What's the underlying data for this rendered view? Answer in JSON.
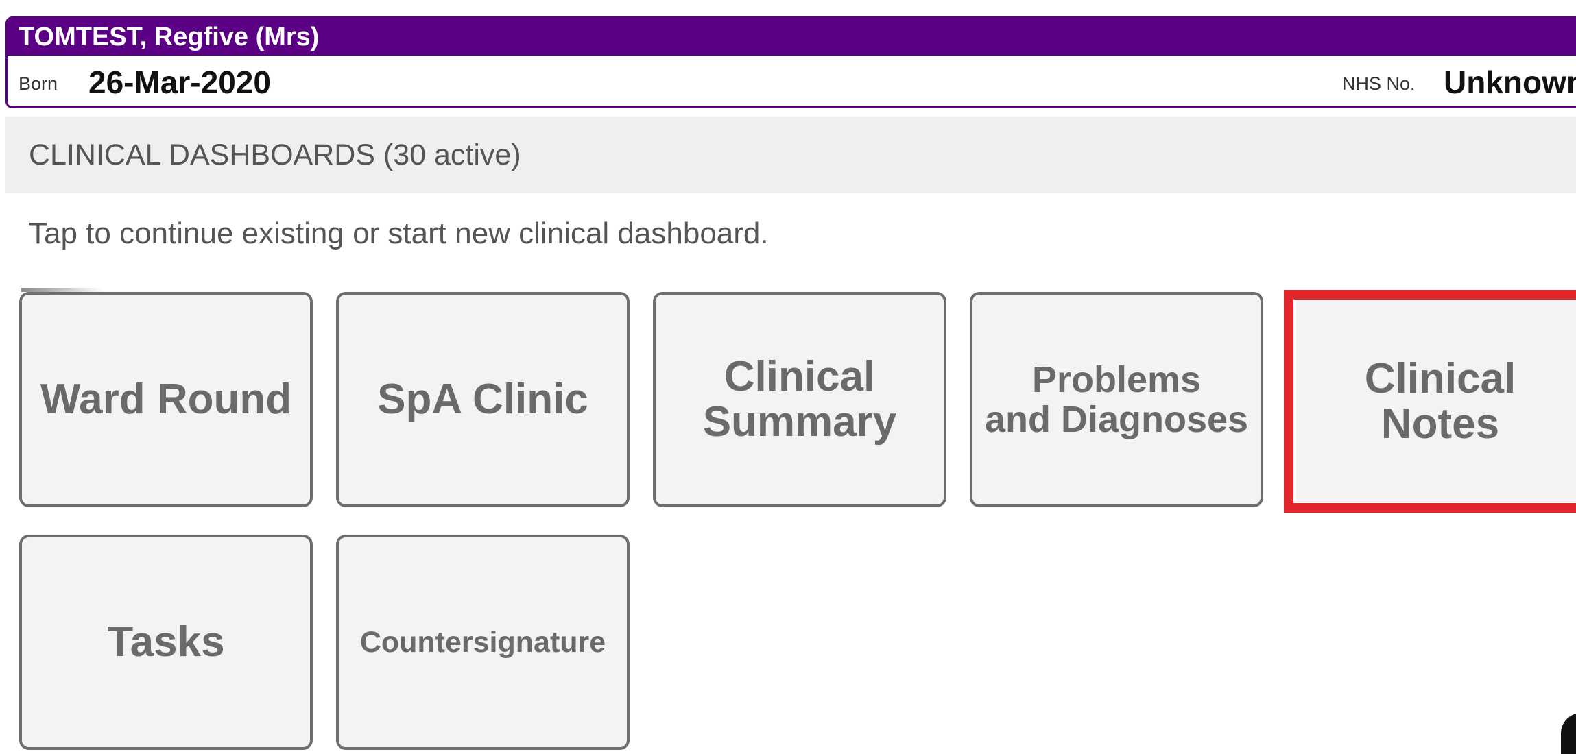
{
  "patient": {
    "name": "TOMTEST, Regfive (Mrs)",
    "born_label": "Born",
    "born_value": "26-Mar-2020",
    "nhs_label": "NHS No.",
    "nhs_value": "Unknown"
  },
  "section": {
    "title": "CLINICAL DASHBOARDS (30 active)",
    "instruction": "Tap to continue existing or start new clinical dashboard."
  },
  "tiles": [
    {
      "label": "Ward Round"
    },
    {
      "label": "SpA Clinic"
    },
    {
      "label": "Clinical\nSummary"
    },
    {
      "label": "Problems\nand Diagnoses"
    },
    {
      "label": "Clinical\nNotes",
      "highlighted": true
    },
    {
      "label": "Tasks"
    },
    {
      "label": "Countersignature"
    }
  ],
  "colors": {
    "banner": "#5b0085",
    "highlight": "#e3262b",
    "tile_border": "#6e6e6e",
    "tile_text": "#6a6a6a"
  }
}
